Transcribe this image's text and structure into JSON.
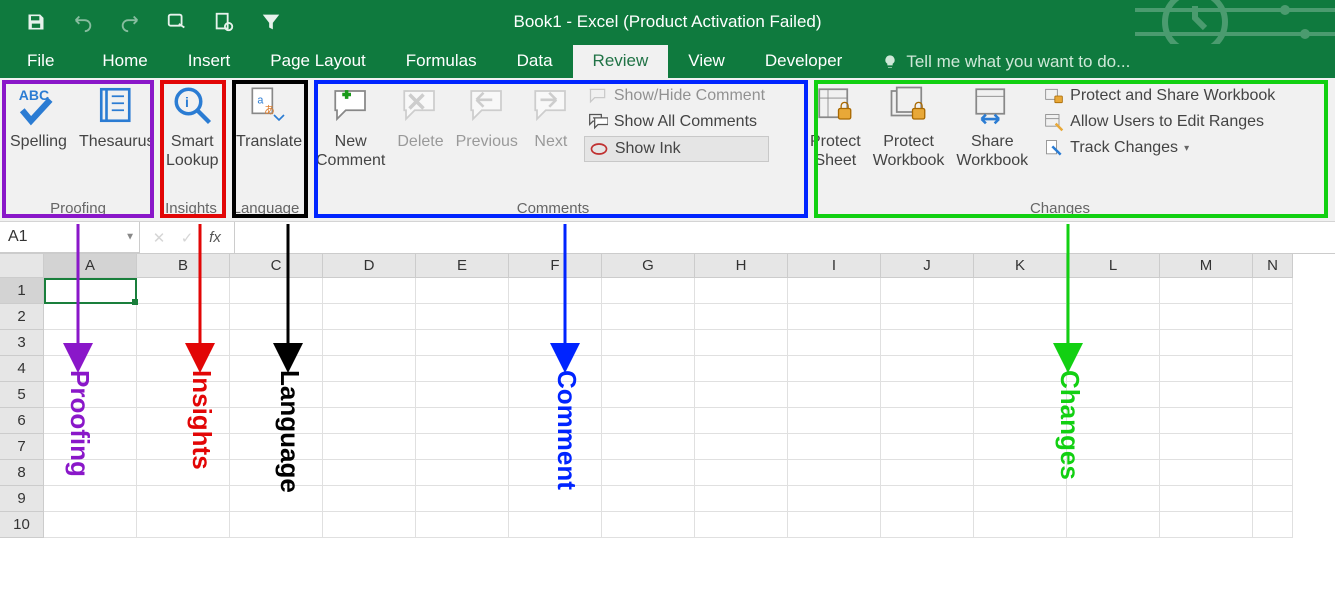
{
  "title": "Book1 - Excel (Product Activation Failed)",
  "tabs": {
    "file": "File",
    "home": "Home",
    "insert": "Insert",
    "page_layout": "Page Layout",
    "formulas": "Formulas",
    "data": "Data",
    "review": "Review",
    "view": "View",
    "developer": "Developer"
  },
  "tellme_placeholder": "Tell me what you want to do...",
  "ribbon": {
    "proofing": {
      "label": "Proofing",
      "spelling": "Spelling",
      "thesaurus": "Thesaurus"
    },
    "insights": {
      "label": "Insights",
      "smart_lookup_l1": "Smart",
      "smart_lookup_l2": "Lookup"
    },
    "language": {
      "label": "Language",
      "translate": "Translate"
    },
    "comments": {
      "label": "Comments",
      "new_l1": "New",
      "new_l2": "Comment",
      "delete": "Delete",
      "previous": "Previous",
      "next": "Next",
      "show_hide": "Show/Hide Comment",
      "show_all": "Show All Comments",
      "show_ink": "Show Ink"
    },
    "changes": {
      "label": "Changes",
      "protect_sheet_l1": "Protect",
      "protect_sheet_l2": "Sheet",
      "protect_wb_l1": "Protect",
      "protect_wb_l2": "Workbook",
      "share_wb_l1": "Share",
      "share_wb_l2": "Workbook",
      "protect_share": "Protect and Share Workbook",
      "allow_users": "Allow Users to Edit Ranges",
      "track_changes": "Track Changes"
    }
  },
  "namebox": "A1",
  "fx_symbol": "fx",
  "columns": [
    "A",
    "B",
    "C",
    "D",
    "E",
    "F",
    "G",
    "H",
    "I",
    "J",
    "K",
    "L",
    "M",
    "N"
  ],
  "rows": [
    "1",
    "2",
    "3",
    "4",
    "5",
    "6",
    "7",
    "8",
    "9",
    "10"
  ],
  "annotations": {
    "proofing": "Proofing",
    "insights": "Insights",
    "language": "Language",
    "comment": "Comment",
    "changes": "Changes"
  }
}
